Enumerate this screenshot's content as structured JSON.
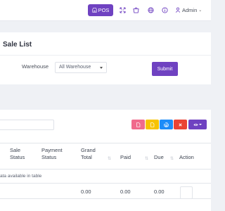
{
  "navbar": {
    "pos_label": "POS",
    "icons": [
      "fullscreen-icon",
      "cart-icon",
      "globe-icon",
      "info-icon"
    ],
    "user_label": "Admin"
  },
  "filter": {
    "title": "Sale List",
    "warehouse_label": "Warehouse",
    "warehouse_value": "All Warehouse",
    "submit_label": "Submit"
  },
  "table": {
    "columns": [
      {
        "line1": "Sale",
        "line2": "Status"
      },
      {
        "line1": "Payment",
        "line2": "Status"
      },
      {
        "line1": "Grand",
        "line2": "Total"
      },
      {
        "line1": "Paid",
        "line2": ""
      },
      {
        "line1": "Due",
        "line2": ""
      },
      {
        "line1": "Action",
        "line2": ""
      }
    ],
    "empty_text": "ata available in table",
    "totals": {
      "grand_total": "0.00",
      "paid": "0.00",
      "due": "0.00"
    }
  },
  "colors": {
    "primary": "#6f42c1",
    "pdf": "#f06a8c",
    "excel": "#f7c300",
    "print": "#1d8cf8",
    "close": "#ea4335"
  }
}
